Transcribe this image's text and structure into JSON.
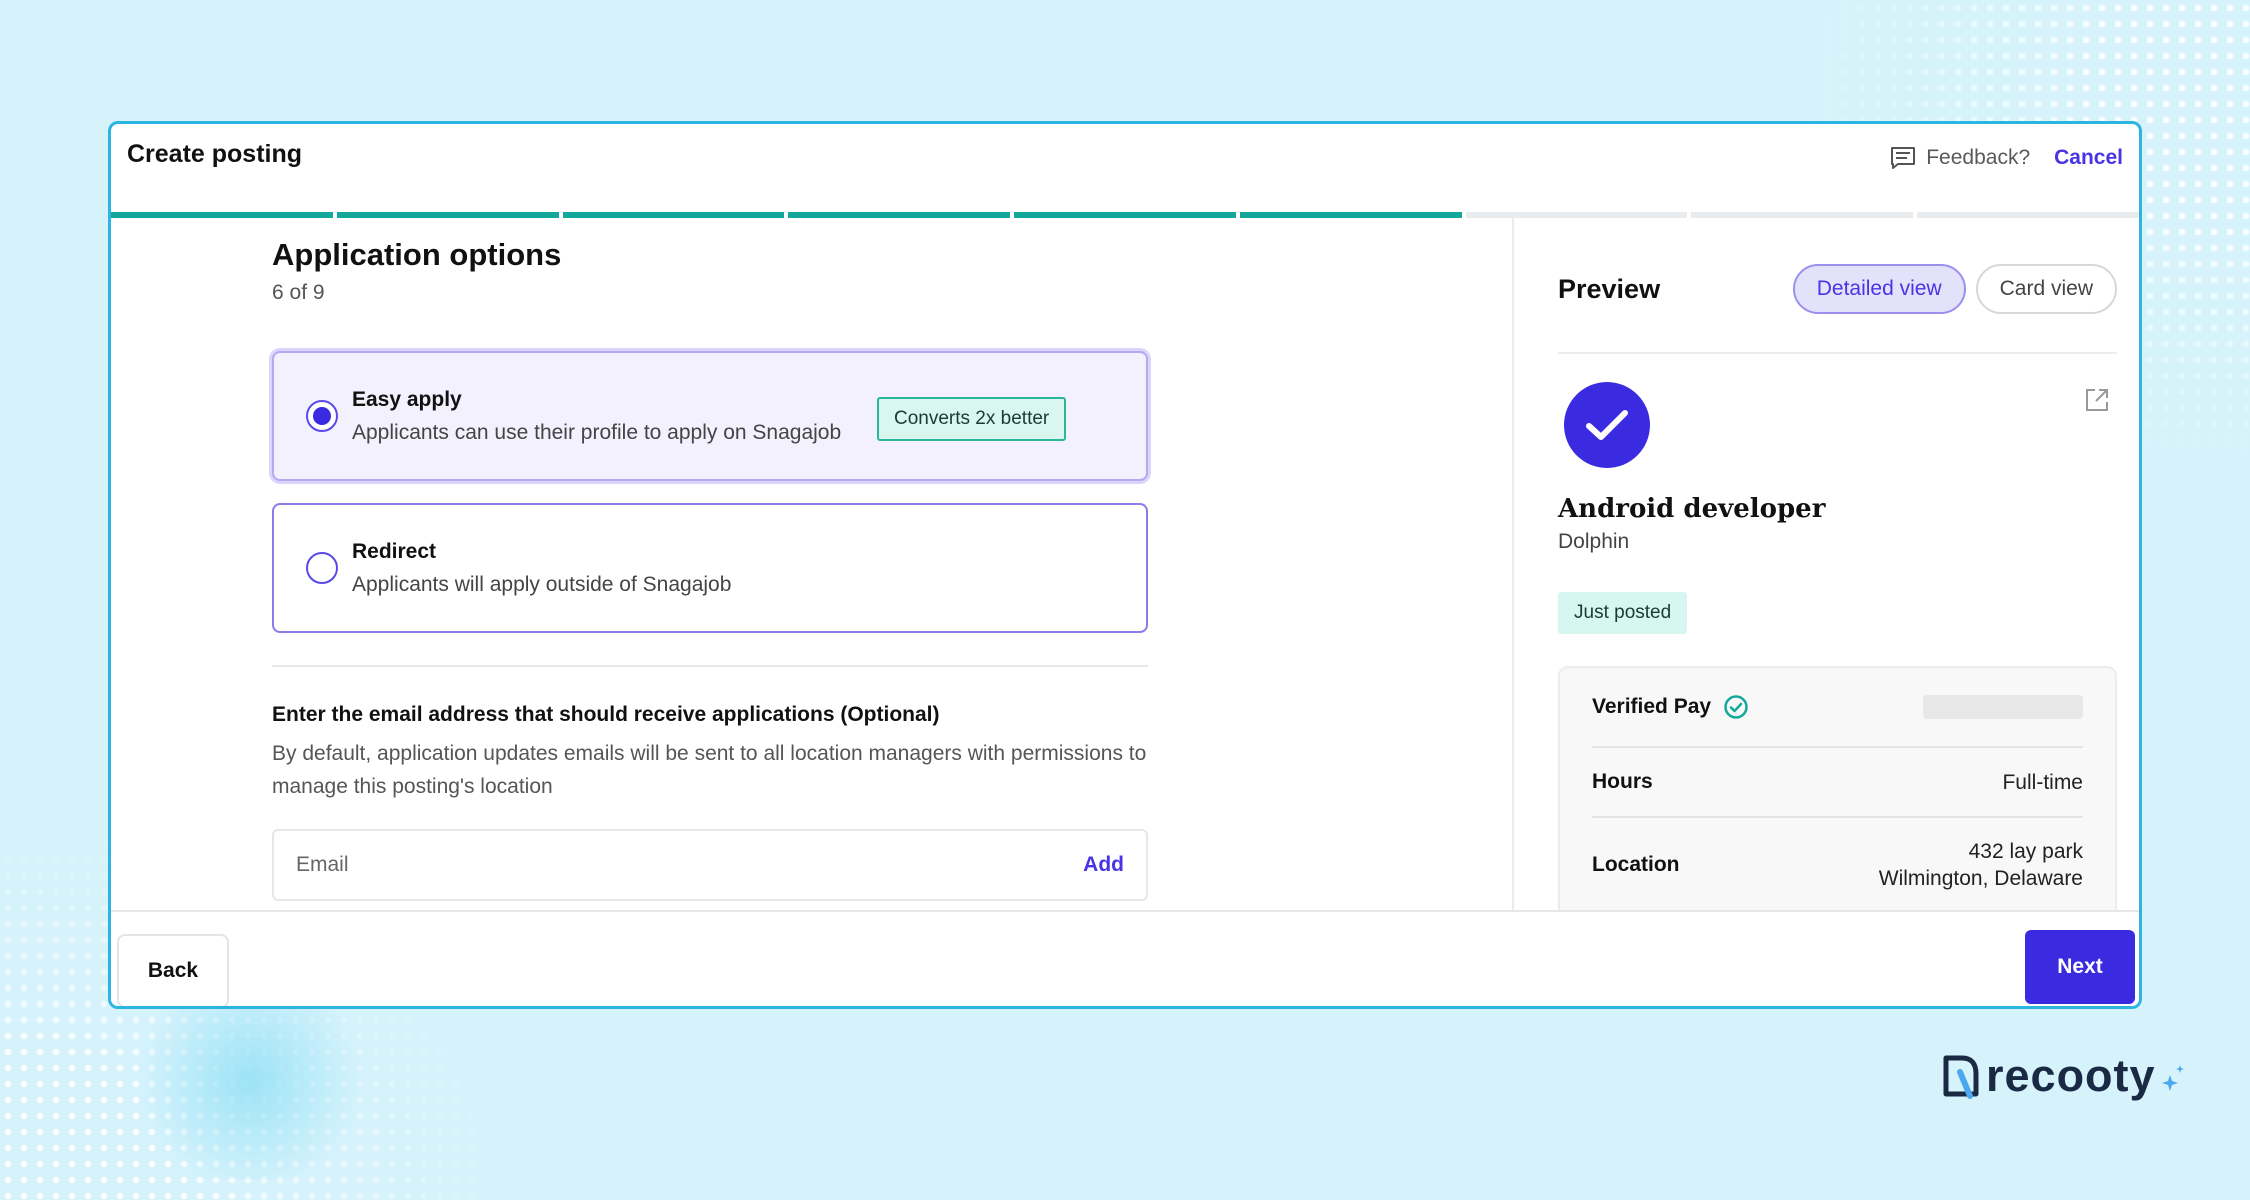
{
  "header": {
    "title": "Create posting",
    "feedback": "Feedback?",
    "cancel": "Cancel"
  },
  "progress": {
    "total_steps": 9,
    "completed_steps": 6
  },
  "section": {
    "title": "Application options",
    "step": "6 of 9"
  },
  "options": [
    {
      "title": "Easy apply",
      "desc": "Applicants can use their profile to apply on Snagajob",
      "badge": "Converts 2x better",
      "selected": true
    },
    {
      "title": "Redirect",
      "desc": "Applicants will apply outside of Snagajob",
      "selected": false
    }
  ],
  "email": {
    "title": "Enter the email address that should receive applications (Optional)",
    "desc": "By default, application updates emails will be sent to all location managers with permissions to manage this posting's location",
    "placeholder": "Email",
    "add": "Add"
  },
  "preview": {
    "title": "Preview",
    "detailed_view": "Detailed view",
    "card_view": "Card view",
    "job_title": "Android developer",
    "company": "Dolphin",
    "badge": "Just posted",
    "details": {
      "verified_pay_label": "Verified Pay",
      "hours_label": "Hours",
      "hours_value": "Full-time",
      "location_label": "Location",
      "location_line1": "432 lay park",
      "location_line2": "Wilmington, Delaware"
    }
  },
  "footer": {
    "back": "Back",
    "next": "Next"
  },
  "brand": {
    "logo_text": "recooty"
  },
  "colors": {
    "primary": "#3a2be0",
    "teal": "#13a89a",
    "border": "#2bb5e0"
  }
}
